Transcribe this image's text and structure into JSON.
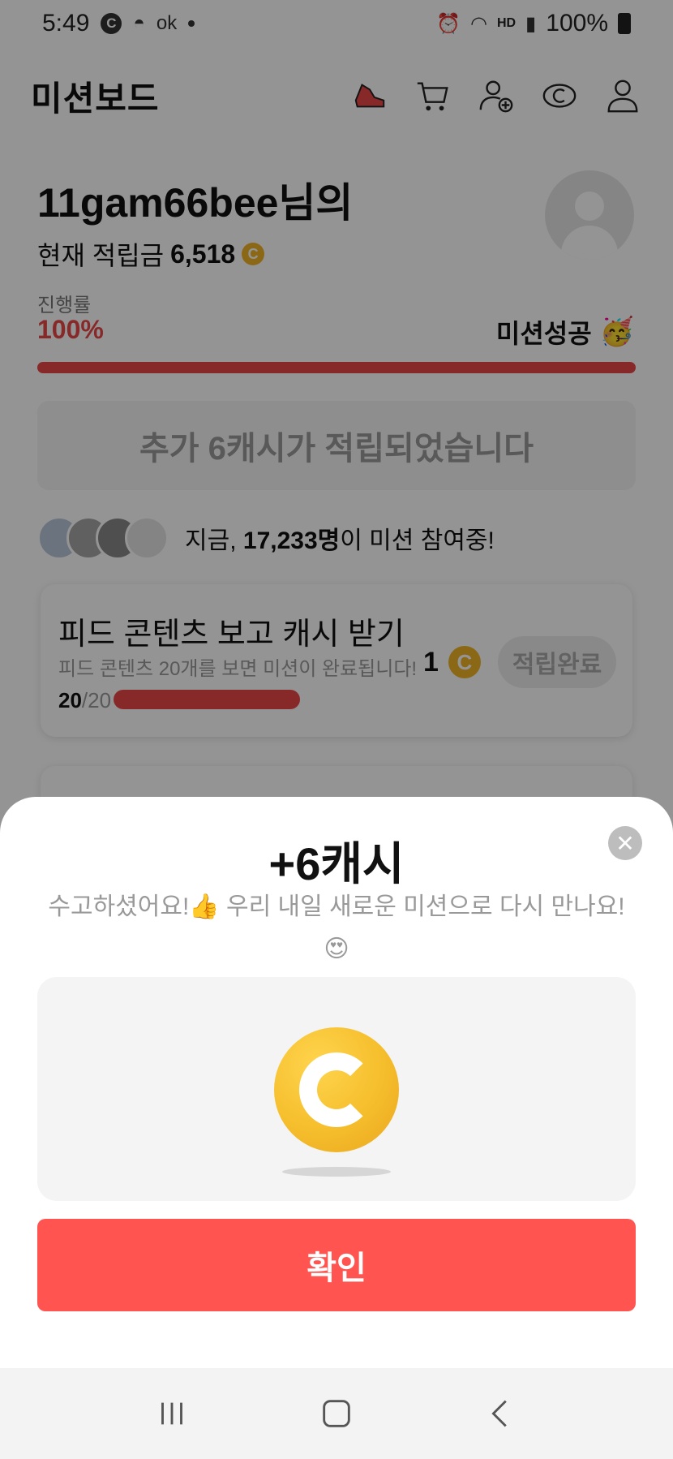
{
  "status_bar": {
    "time": "5:49",
    "battery": "100%",
    "network": "HD",
    "icons": [
      "c-icon",
      "game-controller-icon",
      "ok-icon",
      "dot-icon",
      "alarm-icon",
      "wifi-icon",
      "signal-icon",
      "battery-icon"
    ]
  },
  "header": {
    "title": "미션보드",
    "icons": [
      "shoe-icon",
      "cart-icon",
      "add-user-icon",
      "coin-icon",
      "profile-icon"
    ]
  },
  "greeting": {
    "name": "11gam66bee님의",
    "balance_prefix": "현재 적립금",
    "balance_value": "6,518",
    "coin_symbol": "C"
  },
  "progress": {
    "label": "진행률",
    "value": "100%",
    "value_fraction": 1.0,
    "status": "미션성공",
    "status_emoji": "🥳"
  },
  "notice": {
    "text": "추가 6캐시가 적립되었습니다"
  },
  "participants": {
    "prefix": "지금,",
    "count": "17,233명",
    "suffix": "이 미션 참여중!"
  },
  "mission": {
    "title": "피드 콘텐츠 보고 캐시 받기",
    "description": "피드 콘텐츠 20개를 보면 미션이 완료됩니다!",
    "count_done": "20",
    "count_total": "/20",
    "reward": "1",
    "reward_coin": "C",
    "button": "적립완료"
  },
  "sheet": {
    "title": "+6캐시",
    "message": "수고하셨어요!👍 우리 내일 새로운 미션으로 다시 만나요!",
    "message_emoji": "😍",
    "close_symbol": "✕",
    "confirm": "확인"
  },
  "colors": {
    "accent": "#e84747",
    "confirm": "#ff5450",
    "coin": "#f0b326"
  }
}
